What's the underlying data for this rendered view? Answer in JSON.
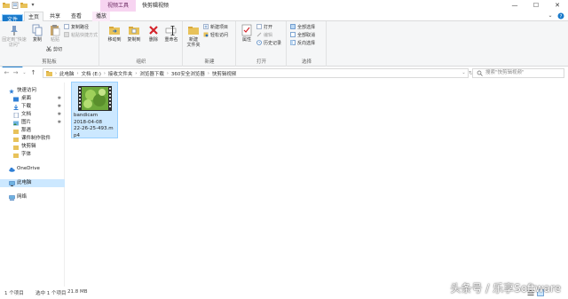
{
  "window": {
    "context_tab": "视频工具",
    "title": "快剪辑视频",
    "minimize": "—",
    "maximize": "☐",
    "close": "✕"
  },
  "tabs": {
    "file": "文件",
    "home": "主页",
    "share": "共享",
    "view": "查看",
    "play": "播放"
  },
  "ribbon": {
    "clipboard": {
      "pin": "固定到“快速访问”",
      "copy": "复制",
      "paste": "粘贴",
      "copy_path": "复制路径",
      "paste_shortcut": "粘贴快捷方式",
      "cut": "剪切",
      "label": "剪贴板"
    },
    "organize": {
      "move_to": "移动到",
      "copy_to": "复制到",
      "delete": "删除",
      "rename": "重命名",
      "label": "组织"
    },
    "new": {
      "new_folder": "新建\n文件夹",
      "new_item": "新建项目",
      "easy_access": "轻松访问",
      "label": "新建"
    },
    "open": {
      "properties": "属性",
      "open": "打开",
      "edit": "编辑",
      "history": "历史记录",
      "label": "打开"
    },
    "select": {
      "select_all": "全部选择",
      "select_none": "全部取消",
      "invert": "反向选择",
      "label": "选择"
    }
  },
  "address": {
    "crumbs": [
      "此电脑",
      "文档 (E:)",
      "接收文件夹",
      "浏览器下载",
      "360安全浏览器",
      "快剪辑视频"
    ],
    "search_placeholder": "搜索\"快剪辑视频\""
  },
  "sidebar": {
    "quick_access": "快速访问",
    "items": [
      "桌面",
      "下载",
      "文档",
      "图片",
      "那遇",
      "课件制作软件",
      "快剪辑",
      "字体"
    ],
    "onedrive": "OneDrive",
    "this_pc": "此电脑",
    "network": "网络"
  },
  "file": {
    "name_lines": [
      "bandicam",
      "2018-04-08",
      "22-26-25-493.m",
      "p4"
    ]
  },
  "status": {
    "count": "1 个项目",
    "selected": "选中 1 个项目",
    "size": "21.8 MB"
  },
  "watermark": "头条号 / 乐享Software",
  "colors": {
    "accent": "#1979ca",
    "selection": "#cce8ff",
    "context_tab": "#f7d4f1"
  }
}
